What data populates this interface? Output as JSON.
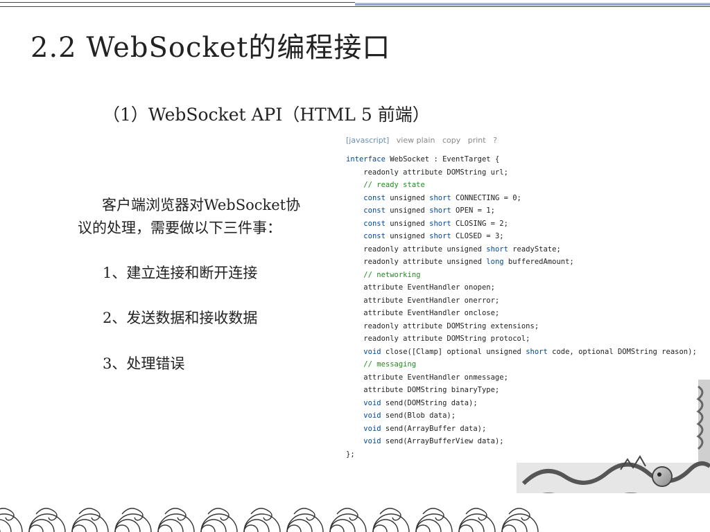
{
  "slide": {
    "title": "2.2 WebSocket的编程接口",
    "subtitle": "（1）WebSocket API（HTML 5 前端）",
    "intro_line1": "客户端浏览器对WebSocket协",
    "intro_line2": "议的处理，需要做以下三件事：",
    "tasks": [
      "1、建立连接和断开连接",
      "2、发送数据和接收数据",
      "3、处理错误"
    ]
  },
  "code_toolbar": {
    "lang": "[javascript]",
    "view_plain": "view plain",
    "copy": "copy",
    "print": "print",
    "help": "?"
  },
  "code_lines": [
    [
      {
        "t": "interface",
        "c": "kw"
      },
      {
        "t": " WebSocket : EventTarget {"
      }
    ],
    [
      {
        "t": "    readonly attribute DOMString url;"
      }
    ],
    [
      {
        "t": "    // ready state",
        "c": "cm"
      }
    ],
    [
      {
        "t": "    "
      },
      {
        "t": "const",
        "c": "kw"
      },
      {
        "t": " unsigned "
      },
      {
        "t": "short",
        "c": "kw"
      },
      {
        "t": " CONNECTING = 0;"
      }
    ],
    [
      {
        "t": "    "
      },
      {
        "t": "const",
        "c": "kw"
      },
      {
        "t": " unsigned "
      },
      {
        "t": "short",
        "c": "kw"
      },
      {
        "t": " OPEN = 1;"
      }
    ],
    [
      {
        "t": "    "
      },
      {
        "t": "const",
        "c": "kw"
      },
      {
        "t": " unsigned "
      },
      {
        "t": "short",
        "c": "kw"
      },
      {
        "t": " CLOSING = 2;"
      }
    ],
    [
      {
        "t": "    "
      },
      {
        "t": "const",
        "c": "kw"
      },
      {
        "t": " unsigned "
      },
      {
        "t": "short",
        "c": "kw"
      },
      {
        "t": " CLOSED = 3;"
      }
    ],
    [
      {
        "t": "    readonly attribute unsigned "
      },
      {
        "t": "short",
        "c": "kw"
      },
      {
        "t": " readyState;"
      }
    ],
    [
      {
        "t": "    readonly attribute unsigned "
      },
      {
        "t": "long",
        "c": "kw"
      },
      {
        "t": " bufferedAmount;"
      }
    ],
    [
      {
        "t": "    // networking",
        "c": "cm"
      }
    ],
    [
      {
        "t": "    attribute EventHandler onopen;"
      }
    ],
    [
      {
        "t": "    attribute EventHandler onerror;"
      }
    ],
    [
      {
        "t": "    attribute EventHandler onclose;"
      }
    ],
    [
      {
        "t": "    readonly attribute DOMString extensions;"
      }
    ],
    [
      {
        "t": "    readonly attribute DOMString protocol;"
      }
    ],
    [
      {
        "t": "    "
      },
      {
        "t": "void",
        "c": "kw"
      },
      {
        "t": " close([Clamp] optional unsigned "
      },
      {
        "t": "short",
        "c": "kw"
      },
      {
        "t": " code, optional DOMString reason);"
      }
    ],
    [
      {
        "t": "    // messaging",
        "c": "cm"
      }
    ],
    [
      {
        "t": "    attribute EventHandler onmessage;"
      }
    ],
    [
      {
        "t": "    attribute DOMString binaryType;"
      }
    ],
    [
      {
        "t": "    "
      },
      {
        "t": "void",
        "c": "kw"
      },
      {
        "t": " send(DOMString data);"
      }
    ],
    [
      {
        "t": "    "
      },
      {
        "t": "void",
        "c": "kw"
      },
      {
        "t": " send(Blob data);"
      }
    ],
    [
      {
        "t": "    "
      },
      {
        "t": "void",
        "c": "kw"
      },
      {
        "t": " send(ArrayBuffer data);"
      }
    ],
    [
      {
        "t": "    "
      },
      {
        "t": "void",
        "c": "kw"
      },
      {
        "t": " send(ArrayBufferView data);"
      }
    ],
    [
      {
        "t": "};"
      }
    ]
  ]
}
